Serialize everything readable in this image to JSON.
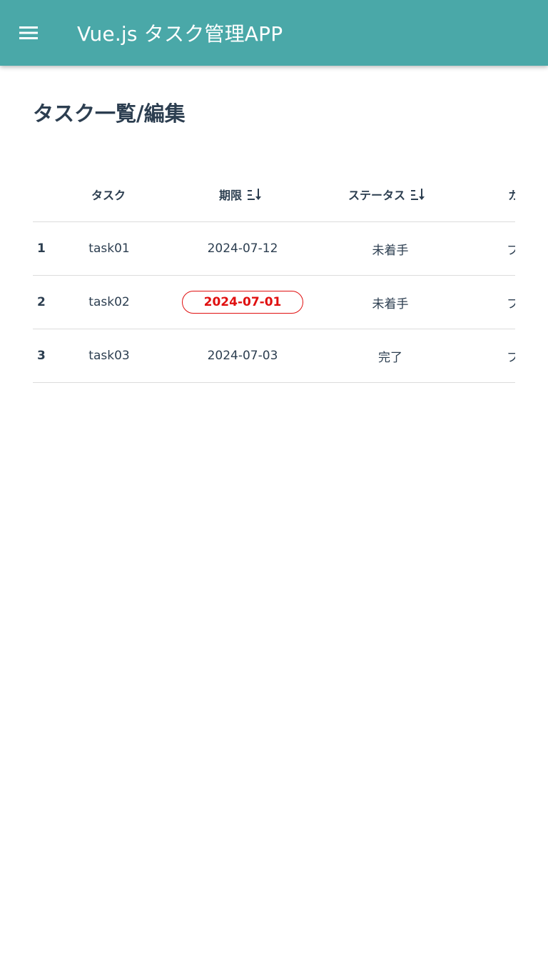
{
  "app": {
    "title": "Vue.js タスク管理APP",
    "bar_color": "#4aa8a8",
    "menu_icon": "hamburger-menu-icon"
  },
  "page": {
    "heading": "タスク一覧/編集"
  },
  "table": {
    "headers": {
      "task": "タスク",
      "due": "期限",
      "status": "ステータス",
      "extra": "カ"
    },
    "sort_icon": "sort-descending-icon",
    "rows": [
      {
        "no": "1",
        "task": "task01",
        "due": "2024-07-12",
        "overdue": false,
        "status": "未着手",
        "extra": "フ"
      },
      {
        "no": "2",
        "task": "task02",
        "due": "2024-07-01",
        "overdue": true,
        "status": "未着手",
        "extra": "フ"
      },
      {
        "no": "3",
        "task": "task03",
        "due": "2024-07-03",
        "overdue": false,
        "status": "完了",
        "extra": "フ"
      }
    ],
    "overdue_color": "#e01010"
  }
}
